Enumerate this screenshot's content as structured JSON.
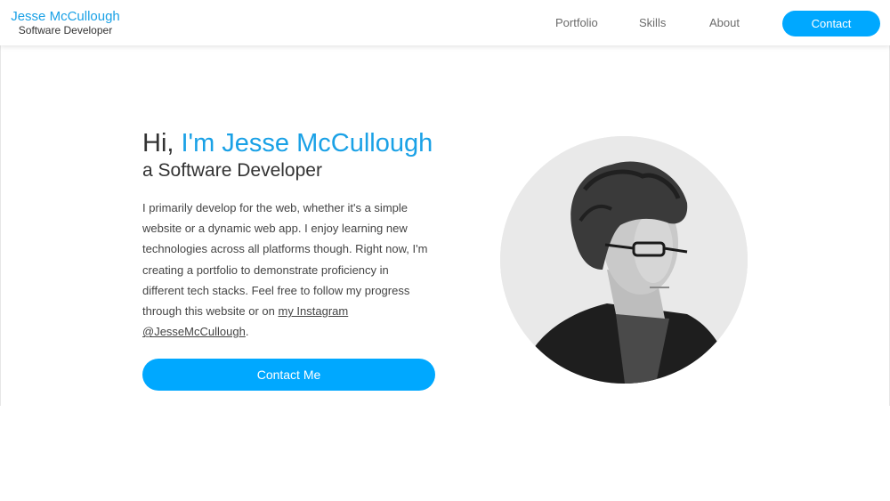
{
  "header": {
    "brand_name": "Jesse McCullough",
    "brand_role": "Software Developer",
    "nav": {
      "portfolio": "Portfolio",
      "skills": "Skills",
      "about": "About"
    },
    "contact_label": "Contact"
  },
  "hero": {
    "greeting": "Hi, ",
    "name_line": "I'm Jesse McCullough",
    "subtitle": "a Software Developer",
    "bio_lines": [
      "I primarily develop for the web, whether it's a simple",
      "website or a dynamic web app. I enjoy learning new",
      "technologies across all platforms though. Right now, I'm",
      "creating a portfolio to demonstrate proficiency in",
      "different tech stacks. Feel free to follow my progress",
      "through this website or on "
    ],
    "instagram_link_text": "my Instagram",
    "instagram_handle": "@JesseMcCullough",
    "bio_end": ".",
    "cta_label": "Contact Me"
  },
  "colors": {
    "accent": "#1aa1e6",
    "button": "#00a8ff",
    "text": "#333333"
  }
}
